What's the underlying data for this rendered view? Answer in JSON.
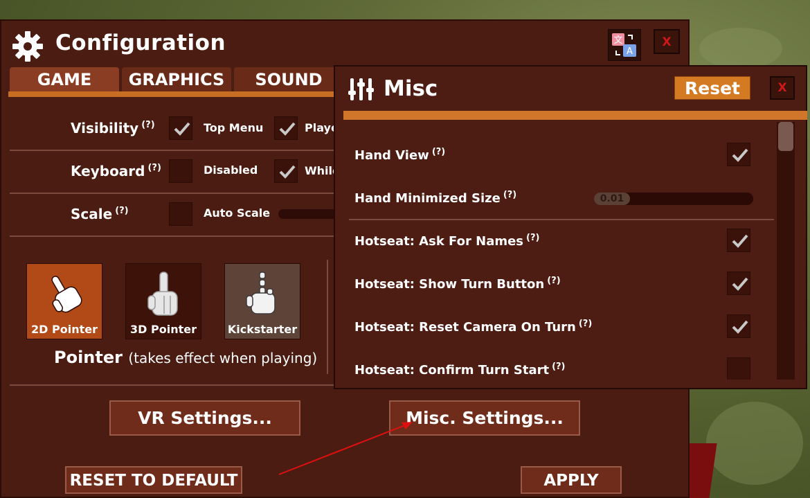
{
  "window": {
    "title": "Configuration",
    "close_label": "X"
  },
  "tabs": [
    {
      "label": "GAME"
    },
    {
      "label": "GRAPHICS"
    },
    {
      "label": "SOUND"
    }
  ],
  "help_marker": "(?)",
  "settings": {
    "visibility": {
      "label": "Visibility",
      "opt1": "Top Menu",
      "opt2": "Playe"
    },
    "keyboard": {
      "label": "Keyboard",
      "opt1": "Disabled",
      "opt2": "While"
    },
    "scale": {
      "label": "Scale",
      "opt1": "Auto Scale"
    }
  },
  "pointer": {
    "options": [
      {
        "label": "2D Pointer",
        "selected": true
      },
      {
        "label": "3D Pointer",
        "selected": false
      },
      {
        "label": "Kickstarter",
        "selected": false
      }
    ],
    "caption": "Pointer",
    "caption_note": "(takes effect when playing)"
  },
  "buttons": {
    "vr_settings": "VR Settings...",
    "misc_settings": "Misc. Settings...",
    "reset_to_default": "RESET TO DEFAULT",
    "apply": "APPLY"
  },
  "misc": {
    "title": "Misc",
    "reset_label": "Reset",
    "close_label": "X",
    "rows": [
      {
        "label": "Hand View",
        "checked": true
      },
      {
        "label": "Hand Minimized Size",
        "slider_value": "0.01"
      },
      {
        "label": "Hotseat: Ask For Names",
        "checked": true
      },
      {
        "label": "Hotseat: Show Turn Button",
        "checked": true
      },
      {
        "label": "Hotseat: Reset Camera On Turn",
        "checked": true
      },
      {
        "label": "Hotseat: Confirm Turn Start",
        "checked": false
      }
    ]
  },
  "colors": {
    "panel": "#4b1c12",
    "accent_orange": "#d0762a",
    "close_red": "#d01818",
    "annotation_arrow": "#e01010"
  }
}
